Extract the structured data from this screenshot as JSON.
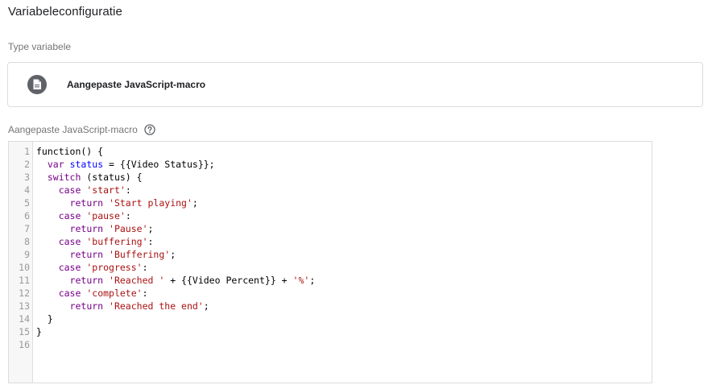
{
  "section": {
    "title": "Variabeleconfiguratie"
  },
  "type": {
    "label": "Type variabele",
    "value": "Aangepaste JavaScript-macro",
    "icon": "document-icon"
  },
  "macro": {
    "label": "Aangepaste JavaScript-macro",
    "help_icon": "help-circle-icon",
    "lines": [
      [
        [
          "plain",
          "function() {"
        ]
      ],
      [
        [
          "plain",
          "  "
        ],
        [
          "kw",
          "var"
        ],
        [
          "plain",
          " "
        ],
        [
          "var",
          "status"
        ],
        [
          "plain",
          " = {{Video Status}};"
        ]
      ],
      [
        [
          "plain",
          "  "
        ],
        [
          "kw",
          "switch"
        ],
        [
          "plain",
          " (status) {"
        ]
      ],
      [
        [
          "plain",
          "    "
        ],
        [
          "kw",
          "case"
        ],
        [
          "plain",
          " "
        ],
        [
          "str",
          "'start'"
        ],
        [
          "plain",
          ":"
        ]
      ],
      [
        [
          "plain",
          "      "
        ],
        [
          "kw",
          "return"
        ],
        [
          "plain",
          " "
        ],
        [
          "str",
          "'Start playing'"
        ],
        [
          "plain",
          ";"
        ]
      ],
      [
        [
          "plain",
          "    "
        ],
        [
          "kw",
          "case"
        ],
        [
          "plain",
          " "
        ],
        [
          "str",
          "'pause'"
        ],
        [
          "plain",
          ":"
        ]
      ],
      [
        [
          "plain",
          "      "
        ],
        [
          "kw",
          "return"
        ],
        [
          "plain",
          " "
        ],
        [
          "str",
          "'Pause'"
        ],
        [
          "plain",
          ";"
        ]
      ],
      [
        [
          "plain",
          "    "
        ],
        [
          "kw",
          "case"
        ],
        [
          "plain",
          " "
        ],
        [
          "str",
          "'buffering'"
        ],
        [
          "plain",
          ":"
        ]
      ],
      [
        [
          "plain",
          "      "
        ],
        [
          "kw",
          "return"
        ],
        [
          "plain",
          " "
        ],
        [
          "str",
          "'Buffering'"
        ],
        [
          "plain",
          ";"
        ]
      ],
      [
        [
          "plain",
          "    "
        ],
        [
          "kw",
          "case"
        ],
        [
          "plain",
          " "
        ],
        [
          "str",
          "'progress'"
        ],
        [
          "plain",
          ":"
        ]
      ],
      [
        [
          "plain",
          "      "
        ],
        [
          "kw",
          "return"
        ],
        [
          "plain",
          " "
        ],
        [
          "str",
          "'Reached '"
        ],
        [
          "plain",
          " + {{Video Percent}} + "
        ],
        [
          "str",
          "'%'"
        ],
        [
          "plain",
          ";"
        ]
      ],
      [
        [
          "plain",
          "    "
        ],
        [
          "kw",
          "case"
        ],
        [
          "plain",
          " "
        ],
        [
          "str",
          "'complete'"
        ],
        [
          "plain",
          ":"
        ]
      ],
      [
        [
          "plain",
          "      "
        ],
        [
          "kw",
          "return"
        ],
        [
          "plain",
          " "
        ],
        [
          "str",
          "'Reached the end'"
        ],
        [
          "plain",
          ";"
        ]
      ],
      [
        [
          "plain",
          "  }"
        ]
      ],
      [
        [
          "plain",
          "}"
        ]
      ],
      []
    ]
  },
  "colors": {
    "keyword": "#770088",
    "variable": "#0000ff",
    "string": "#aa1111",
    "icon_bg": "#5f6368"
  }
}
